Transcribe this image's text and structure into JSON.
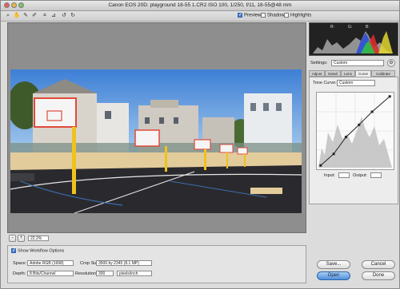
{
  "window": {
    "title": "Canon EOS 20D:  playground 18-55 1.CR2  ISO 100, 1/250, f/11, 18-55@48 mm"
  },
  "toolbar": {
    "tools": [
      {
        "name": "zoom-tool",
        "glyph": "🔍"
      },
      {
        "name": "hand-tool",
        "glyph": "✋"
      },
      {
        "name": "white-balance-tool",
        "glyph": "✎"
      },
      {
        "name": "color-sampler-tool",
        "glyph": "✎"
      },
      {
        "name": "crop-tool",
        "glyph": "⌗"
      },
      {
        "name": "straighten-tool",
        "glyph": "⊿"
      },
      {
        "name": "rotate-ccw-tool",
        "glyph": "↺"
      },
      {
        "name": "rotate-cw-tool",
        "glyph": "↻"
      }
    ],
    "preview_label": "Preview",
    "shadows_label": "Shadows",
    "highlights_label": "Highlights"
  },
  "histogram": {
    "r_label": "R:",
    "g_label": "G:",
    "b_label": "B:"
  },
  "settings": {
    "label": "Settings:",
    "value": "Custom"
  },
  "tabs": [
    {
      "label": "Adjust"
    },
    {
      "label": "Detail"
    },
    {
      "label": "Lens"
    },
    {
      "label": "Curve"
    },
    {
      "label": "Calibrate"
    }
  ],
  "curve": {
    "label": "Tone Curve:",
    "value": "Custom",
    "input_label": "Input:",
    "output_label": "Output:",
    "points": [
      [
        0.05,
        0.95
      ],
      [
        0.22,
        0.8
      ],
      [
        0.38,
        0.58
      ],
      [
        0.55,
        0.42
      ],
      [
        0.72,
        0.25
      ],
      [
        0.95,
        0.05
      ]
    ]
  },
  "zoom": {
    "value": "22.2%"
  },
  "workflow": {
    "show_label": "Show Workflow Options",
    "space_label": "Space:",
    "space_value": "Adobe RGB (1998)",
    "size_label": "Crop Size:",
    "size_value": "3500 by 2345  (8.1 MP)",
    "depth_label": "Depth:",
    "depth_value": "8 Bits/Channel",
    "resolution_label": "Resolution:",
    "resolution_value": "300",
    "resolution_unit": "pixels/inch"
  },
  "buttons": {
    "save": "Save...",
    "cancel": "Cancel",
    "open": "Open",
    "done": "Done"
  }
}
